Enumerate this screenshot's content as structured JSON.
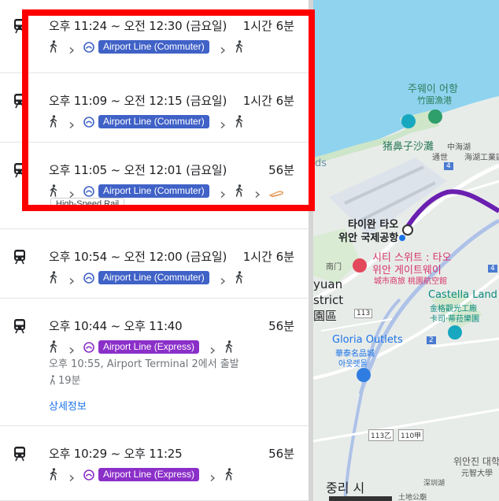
{
  "routes": [
    {
      "times": "오후 11:24 ~ 오전 12:30 (금요일)",
      "duration": "1시간 6분",
      "line": "Airport Line (Commuter)",
      "line_type": "commuter"
    },
    {
      "times": "오후 11:09 ~ 오전 12:15 (금요일)",
      "duration": "1시간 6분",
      "line": "Airport Line (Commuter)",
      "line_type": "commuter"
    },
    {
      "times": "오후 11:05 ~ 오전 12:01 (금요일)",
      "duration": "56분",
      "line": "Airport Line (Commuter)",
      "line_type": "commuter",
      "extra_tag": "High-Speed Rail"
    },
    {
      "times": "오후 10:54 ~ 오전 12:00 (금요일)",
      "duration": "1시간 6분",
      "line": "Airport Line (Commuter)",
      "line_type": "commuter"
    },
    {
      "times": "오후 10:44 ~ 오후 11:40",
      "duration": "56분",
      "line": "Airport Line (Express)",
      "line_type": "express",
      "departure_info": "오후 10:55, Airport Terminal 2에서 출발",
      "walk_info": "19분",
      "details_link": "상세정보"
    },
    {
      "times": "오후 10:29 ~ 오후 11:25",
      "duration": "56분",
      "line": "Airport Line (Express)",
      "line_type": "express"
    }
  ],
  "colors": {
    "commuter": "#4062c7",
    "express": "#8b2fc9",
    "highlight": "#ff0000",
    "link": "#1a73e8"
  },
  "map": {
    "labels": {
      "zhuwei": "주웨이 어항",
      "zhuwei_zh": "竹圍漁港",
      "zhubi": "猪鼻子沙灘",
      "zhonghu": "中海湖",
      "haihu": "海湖工業區",
      "tongshi": "通世",
      "ds": "ds",
      "airport1": "타이완 타오",
      "airport2": "위안 국제공항",
      "nankan": "南门",
      "citysuites1": "시티 스위트 : 타오",
      "citysuites2": "위안 게이트웨이",
      "citysuites_zh": "城市商旅 桃園航空館",
      "yuan": "yuan",
      "strict": "strict",
      "yuanqu": "園區",
      "castella": "Castella Land",
      "castella_zh1": "金格觀光工廠",
      "castella_zh2": "卡司·蒂菈樂園",
      "gloria": "Gloria Outlets",
      "gloria_zh": "華泰名品城",
      "gloria_ko": "아웃렛몰",
      "r113": "113",
      "r113n": "113乙",
      "r110": "110甲",
      "r4": "4",
      "r4b": "4",
      "r2": "2",
      "taoyuanstn": "위안진 대학",
      "yuanzhi": "元智大學",
      "zhongli": "중리 시",
      "shenzhi": "深圳湖",
      "tudi": "土地公廟"
    }
  }
}
